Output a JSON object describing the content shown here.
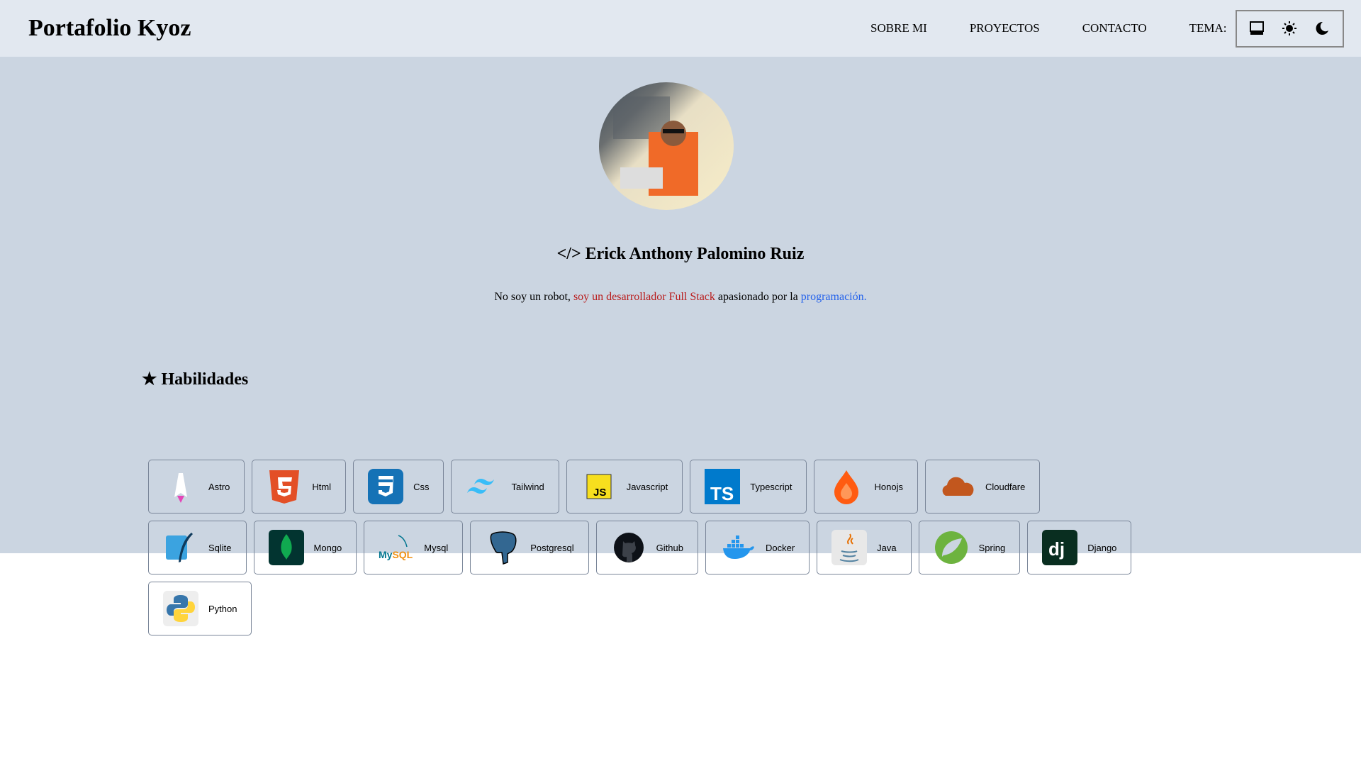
{
  "header": {
    "title": "Portafolio Kyoz",
    "nav": [
      "SOBRE MI",
      "PROYECTOS",
      "CONTACTO"
    ],
    "theme_label": "TEMA:"
  },
  "profile": {
    "name": "</> Erick Anthony Palomino Ruiz",
    "desc_1": "No soy un robot, ",
    "desc_red": "soy un desarrollador Full Stack",
    "desc_2": " apasionado por la ",
    "desc_blue": "programación."
  },
  "skills": {
    "title": "★ Habilidades",
    "items": [
      "Astro",
      "Html",
      "Css",
      "Tailwind",
      "Javascript",
      "Typescript",
      "Honojs",
      "Cloudfare",
      "Sqlite",
      "Mongo",
      "Mysql",
      "Postgresql",
      "Github",
      "Docker",
      "Java",
      "Spring",
      "Django",
      "Python"
    ]
  }
}
